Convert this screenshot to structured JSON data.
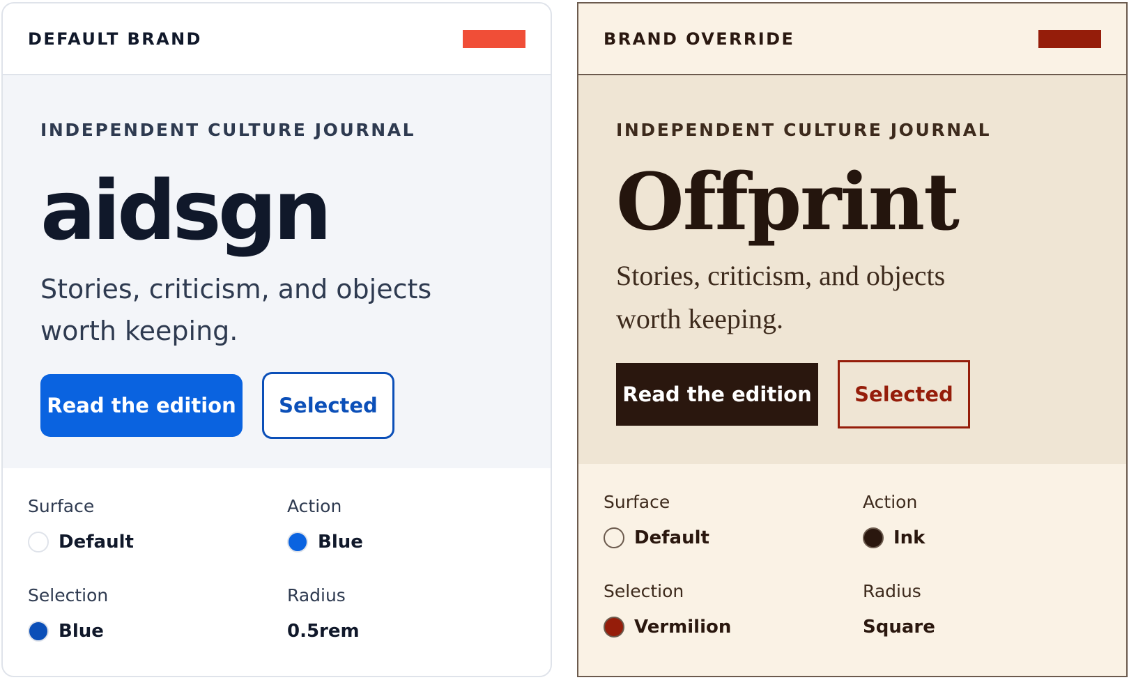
{
  "panels": [
    {
      "header": {
        "title": "DEFAULT BRAND",
        "swatch_color": "#f04e37"
      },
      "kicker": "INDEPENDENT CULTURE JOURNAL",
      "wordmark": "aidsgn",
      "tagline": "Stories, criticism, and objects worth keeping.",
      "primary_button": "Read the edition",
      "secondary_button": "Selected",
      "tokens": {
        "surface": {
          "label": "Surface",
          "value": "Default",
          "color": "#ffffff"
        },
        "action": {
          "label": "Action",
          "value": "Blue",
          "color": "#0a63e0"
        },
        "selection": {
          "label": "Selection",
          "value": "Blue",
          "color": "#0b4fb8"
        },
        "radius": {
          "label": "Radius",
          "value": "0.5rem"
        }
      }
    },
    {
      "header": {
        "title": "BRAND OVERRIDE",
        "swatch_color": "#951d0a"
      },
      "kicker": "INDEPENDENT CULTURE JOURNAL",
      "wordmark": "Offprint",
      "tagline": "Stories, criticism, and objects worth keeping.",
      "primary_button": "Read the edition",
      "secondary_button": "Selected",
      "tokens": {
        "surface": {
          "label": "Surface",
          "value": "Default",
          "color": "#faf2e5"
        },
        "action": {
          "label": "Action",
          "value": "Ink",
          "color": "#2a170e"
        },
        "selection": {
          "label": "Selection",
          "value": "Vermilion",
          "color": "#951d0a"
        },
        "radius": {
          "label": "Radius",
          "value": "Square"
        }
      }
    }
  ]
}
